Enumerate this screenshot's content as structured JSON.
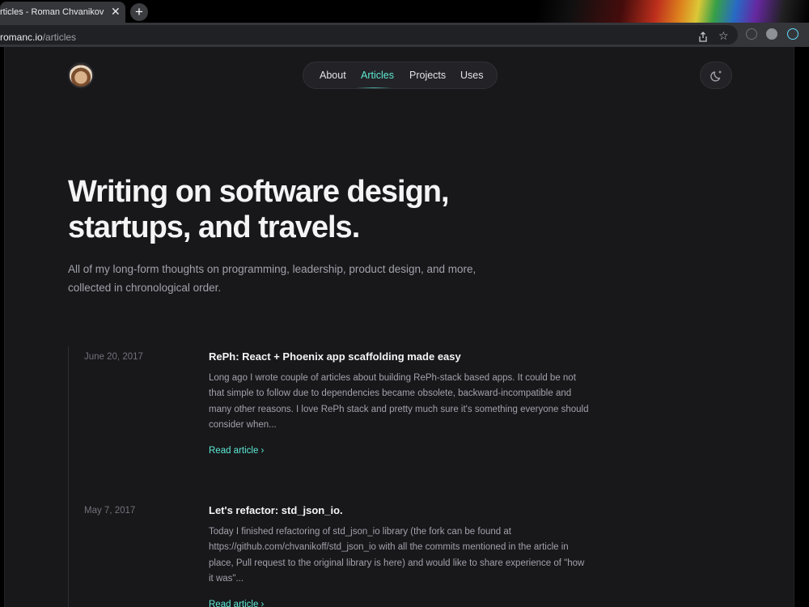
{
  "browser": {
    "tab_title": "rticles - Roman Chvanikov",
    "tab_close": "✕",
    "new_tab": "+",
    "url_host": "romanc.io",
    "url_path": "/articles"
  },
  "site": {
    "nav": [
      "About",
      "Articles",
      "Projects",
      "Uses"
    ],
    "active_nav": "Articles"
  },
  "hero": {
    "headline_line1": "Writing on software design,",
    "headline_line2": "startups, and travels.",
    "intro": "All of my long-form thoughts on programming, leadership, product design, and more, collected in chronological order."
  },
  "articles": [
    {
      "date": "June 20, 2017",
      "title": "RePh: React + Phoenix app scaffolding made easy",
      "description": "Long ago I wrote couple of articles about building RePh-stack based apps. It could be not that simple to follow due to dependencies became obsolete, backward-incompatible and many other reasons. I love RePh stack and pretty much sure it's something everyone should consider when...",
      "link": "Read article  ›"
    },
    {
      "date": "May 7, 2017",
      "title": "Let's refactor: std_json_io.",
      "description": "Today I finished refactoring of std_json_io library (the fork can be found at https://github.com/chvanikoff/std_json_io with all the commits mentioned in the article in place, Pull request to the original library is here) and would like to share experience of \"how it was\"...",
      "link": "Read article  ›"
    }
  ],
  "colors": {
    "accent": "#5eead4",
    "background": "#18181b"
  }
}
